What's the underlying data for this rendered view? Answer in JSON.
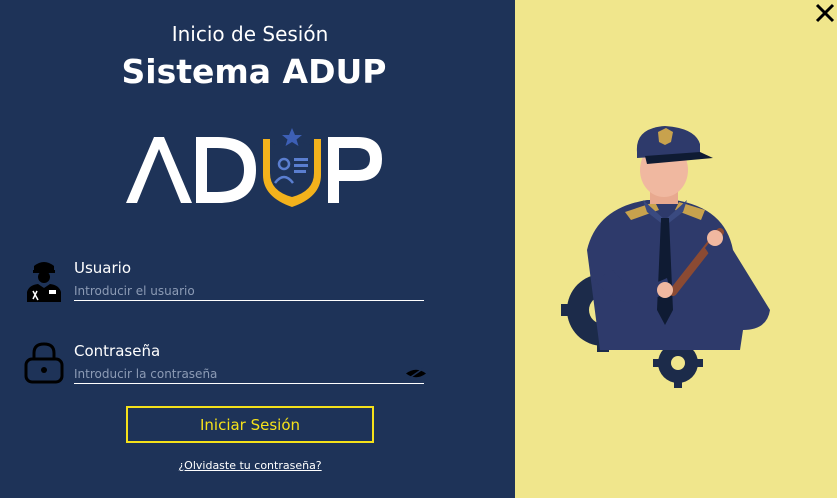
{
  "header": {
    "subtitle": "Inicio de Sesión",
    "title": "Sistema ADUP"
  },
  "logo": {
    "text": "ADUP",
    "colors": {
      "letters": "#ffffff",
      "shield": "#f3b21c",
      "star": "#3d5fb5"
    }
  },
  "form": {
    "username": {
      "label": "Usuario",
      "placeholder": "Introducir el usuario",
      "value": "",
      "icon": "police-officer-icon"
    },
    "password": {
      "label": "Contraseña",
      "placeholder": "Introducir la contraseña",
      "value": "",
      "icon": "lock-icon",
      "toggle_icon": "eye-hidden-icon"
    },
    "submit_label": "Iniciar Sesión",
    "forgot_label": "¿Olvidaste tu contraseña?"
  },
  "window": {
    "close_icon": "close-icon"
  },
  "illustration": {
    "icon": "security-guard-illustration"
  },
  "colors": {
    "left_background": "#1e3358",
    "right_background": "#f0e68c",
    "accent": "#f5e11a",
    "text": "#ffffff"
  }
}
